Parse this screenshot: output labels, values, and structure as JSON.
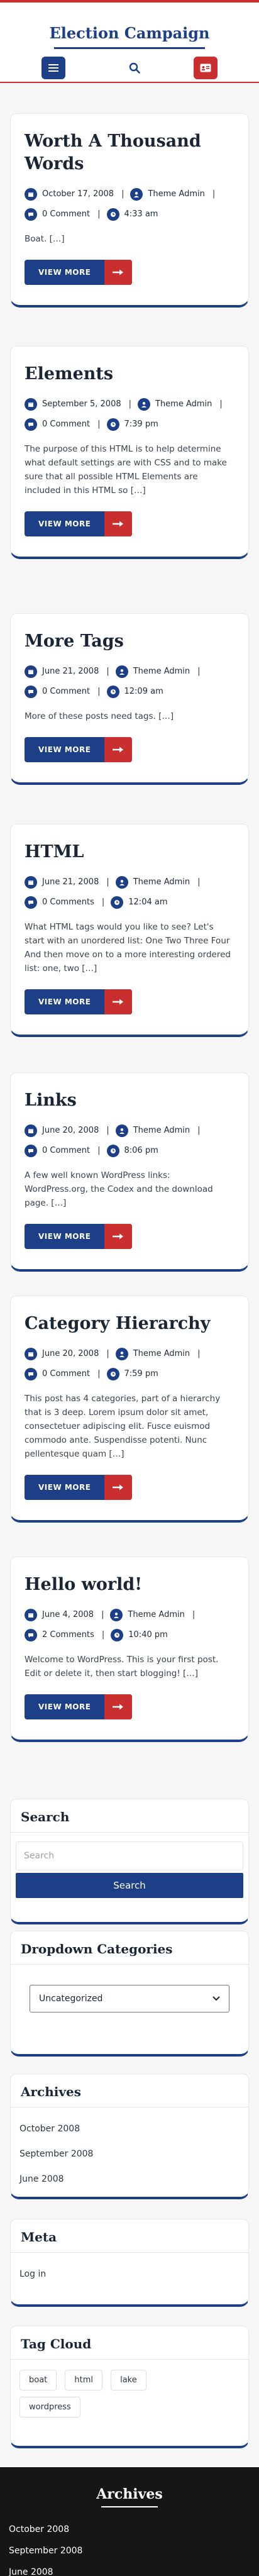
{
  "site": {
    "title": "Election Campaign"
  },
  "header": {
    "menu_icon": "menu-icon",
    "search_icon": "search-icon",
    "card_icon": "id-card-icon"
  },
  "posts": [
    {
      "title": "Worth A Thousand Words",
      "date": "October 17, 2008",
      "author": "Theme Admin",
      "comments": "0 Comment",
      "time": "4:33 am",
      "excerpt": "Boat. […]",
      "cta": "VIEW MORE"
    },
    {
      "title": "Elements",
      "date": "September 5, 2008",
      "author": "Theme Admin",
      "comments": "0 Comment",
      "time": "7:39 pm",
      "excerpt": "The purpose of this HTML is to help determine what default settings are with CSS and to make sure that all possible HTML Elements are included in this HTML so […]",
      "cta": "VIEW MORE"
    },
    {
      "title": "More Tags",
      "date": "June 21, 2008",
      "author": "Theme Admin",
      "comments": "0 Comment",
      "time": "12:09 am",
      "excerpt": "More of these posts need tags. […]",
      "cta": "VIEW MORE"
    },
    {
      "title": "HTML",
      "date": "June 21, 2008",
      "author": "Theme Admin",
      "comments": "0 Comments",
      "time": "12:04 am",
      "excerpt": "What HTML tags would you like to see? Let's start with an unordered list: One Two Three Four And then move on to a more interesting ordered list: one, two […]",
      "cta": "VIEW MORE"
    },
    {
      "title": "Links",
      "date": "June 20, 2008",
      "author": "Theme Admin",
      "comments": "0 Comment",
      "time": "8:06 pm",
      "excerpt": "A few well known WordPress links: WordPress.org, the Codex and the download page. […]",
      "cta": "VIEW MORE"
    },
    {
      "title": "Category Hierarchy",
      "date": "June 20, 2008",
      "author": "Theme Admin",
      "comments": "0 Comment",
      "time": "7:59 pm",
      "excerpt": "This post has 4 categories, part of a hierarchy that is 3 deep. Lorem ipsum dolor sit amet, consectetuer adipiscing elit. Fusce euismod commodo ante. Suspendisse potenti. Nunc pellentesque quam […]",
      "cta": "VIEW MORE"
    },
    {
      "title": "Hello world!",
      "date": "June 4, 2008",
      "author": "Theme Admin",
      "comments": "2 Comments",
      "time": "10:40 pm",
      "excerpt": "Welcome to WordPress. This is your first post. Edit or delete it, then start blogging! […]",
      "cta": "VIEW MORE"
    }
  ],
  "widgets": {
    "search": {
      "title": "Search",
      "placeholder": "Search",
      "button": "Search"
    },
    "dropdown_categories": {
      "title": "Dropdown Categories",
      "selected": "Uncategorized"
    },
    "archives": {
      "title": "Archives",
      "items": [
        "October 2008",
        "September 2008",
        "June 2008"
      ]
    },
    "meta": {
      "title": "Meta",
      "items": [
        "Log in"
      ]
    },
    "tag_cloud": {
      "title": "Tag Cloud",
      "tags": [
        "boat",
        "html",
        "lake",
        "wordpress"
      ]
    }
  },
  "footer": {
    "title": "Archives",
    "items": [
      "October 2008",
      "September 2008",
      "June 2008"
    ]
  },
  "colors": {
    "primary": "#1c3f87",
    "accent": "#c92f2f",
    "footer_bg": "#141617"
  }
}
